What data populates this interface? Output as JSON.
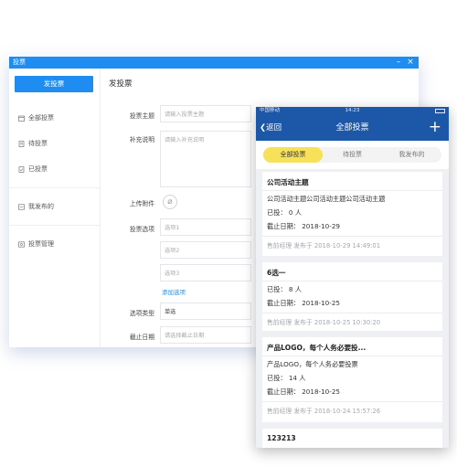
{
  "desktop": {
    "window_title": "投票",
    "new_vote_button": "发投票",
    "nav": [
      {
        "label": "全部投票",
        "icon": "calendar-icon"
      },
      {
        "label": "待投票",
        "icon": "doc-icon"
      },
      {
        "label": "已投票",
        "icon": "check-doc-icon"
      },
      {
        "label": "我发布的",
        "icon": "list-icon"
      },
      {
        "label": "投票管理",
        "icon": "settings-icon"
      }
    ],
    "form": {
      "title": "发投票",
      "subject_label": "投票主题",
      "subject_placeholder": "请输入投票主题",
      "desc_label": "补充说明",
      "desc_placeholder": "请输入补充说明",
      "attach_label": "上传附件",
      "options_label": "投票选项",
      "options": [
        "选项1",
        "选项2",
        "选项3"
      ],
      "add_option": "添加选项",
      "type_label": "选项类型",
      "type_value": "单选",
      "deadline_label": "截止日期",
      "deadline_placeholder": "请选择截止日期"
    }
  },
  "mobile": {
    "carrier": "中国移动",
    "time": "14:23",
    "back": "返回",
    "title": "全部投票",
    "plus": "+",
    "tabs": [
      "全部投票",
      "待投票",
      "我发布的"
    ],
    "active_tab": 0,
    "cards": [
      {
        "title": "公司活动主题",
        "desc": "公司活动主题公司活动主题公司活动主题",
        "voted": "已投： 0 人",
        "deadline": "截止日期： 2018-10-29",
        "footer": "售前经理 发布于 2018-10-29 14:49:01"
      },
      {
        "title": "6选一",
        "desc": "",
        "voted": "已投： 8 人",
        "deadline": "截止日期： 2018-10-25",
        "footer": "售前经理 发布于 2018-10-25 10:30:20"
      },
      {
        "title": "产品LOGO，每个人务必要投...",
        "desc": "产品LOGO，每个人务必要投票",
        "voted": "已投： 14 人",
        "deadline": "截止日期： 2018-10-25",
        "footer": "售前经理 发布于 2018-10-24 15:57:26"
      },
      {
        "title": "123213",
        "desc": "",
        "voted": "",
        "deadline": "",
        "footer": ""
      }
    ]
  }
}
